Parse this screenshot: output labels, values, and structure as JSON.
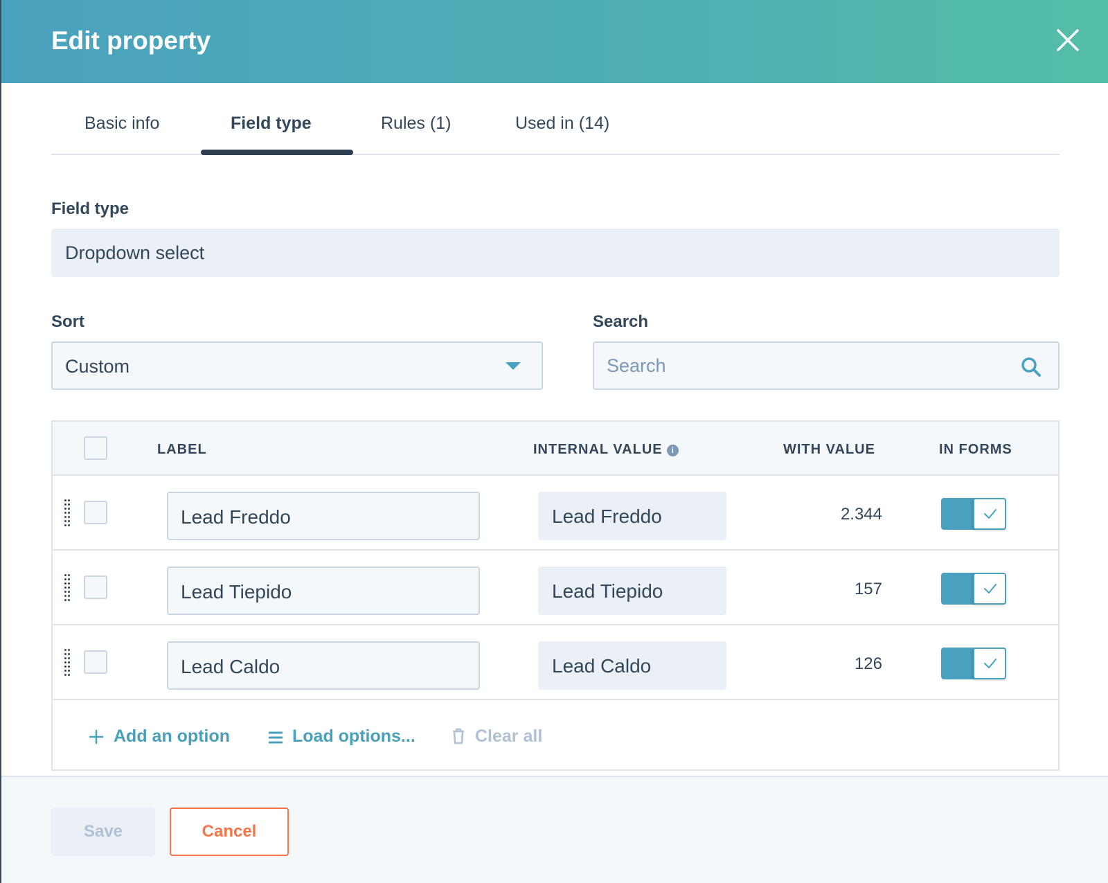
{
  "header": {
    "title": "Edit property",
    "close_icon": "close-icon"
  },
  "tabs": [
    {
      "label": "Basic info",
      "active": false
    },
    {
      "label": "Field type",
      "active": true
    },
    {
      "label": "Rules (1)",
      "active": false
    },
    {
      "label": "Used in (14)",
      "active": false
    }
  ],
  "field_type": {
    "label": "Field type",
    "value": "Dropdown select"
  },
  "sort": {
    "label": "Sort",
    "value": "Custom"
  },
  "search": {
    "label": "Search",
    "placeholder": "Search"
  },
  "table": {
    "columns": [
      "LABEL",
      "INTERNAL VALUE",
      "WITH VALUE",
      "IN FORMS"
    ],
    "rows": [
      {
        "label": "Lead Freddo",
        "internal_value": "Lead Freddo",
        "with_value": "2.344",
        "in_forms": true
      },
      {
        "label": "Lead Tiepido",
        "internal_value": "Lead Tiepido",
        "with_value": "157",
        "in_forms": true
      },
      {
        "label": "Lead Caldo",
        "internal_value": "Lead Caldo",
        "with_value": "126",
        "in_forms": true
      }
    ],
    "actions": {
      "add": "Add an option",
      "load": "Load options...",
      "clear": "Clear all"
    }
  },
  "footer": {
    "save": "Save",
    "cancel": "Cancel"
  },
  "colors": {
    "accent": "#4aa1bd",
    "header_start": "#4aa1bd",
    "header_end": "#54bea6",
    "cancel": "#f2754c",
    "text": "#33475b"
  }
}
